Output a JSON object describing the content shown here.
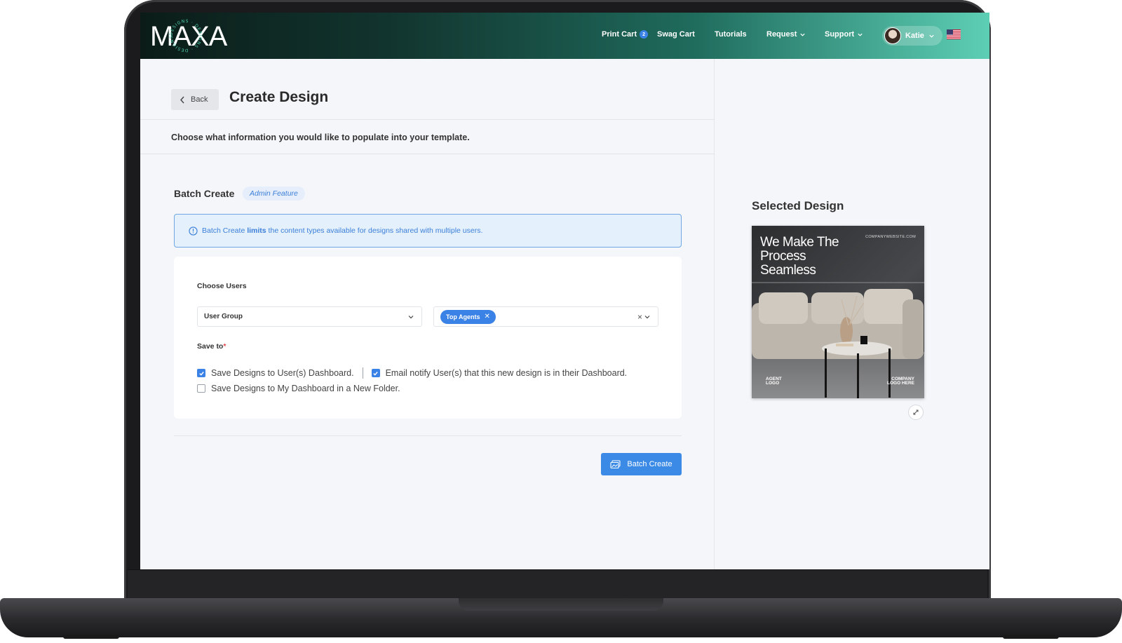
{
  "nav": {
    "logo_text": "MAXA",
    "logo_ring_text": "DESIGNS · DESIGNS · DESIGNS ·",
    "print_cart": "Print Cart",
    "print_cart_count": "2",
    "swag_cart": "Swag Cart",
    "tutorials": "Tutorials",
    "request": "Request",
    "support": "Support",
    "user_name": "Katie",
    "flag_icon": "us-flag-icon"
  },
  "header": {
    "back_label": "Back",
    "title": "Create Design",
    "subtitle": "Choose what information you would like to populate into your template."
  },
  "batch": {
    "title": "Batch Create",
    "badge": "Admin Feature",
    "info_prefix": "Batch Create ",
    "info_bold": "limits",
    "info_suffix": " the content types available for designs shared with multiple users.",
    "choose_users_label": "Choose Users",
    "user_select_value": "User Group",
    "group_chip": "Top Agents",
    "save_to_label": "Save to",
    "required_mark": "*",
    "options": [
      {
        "label": "Save Designs to User(s) Dashboard.",
        "checked": true
      },
      {
        "label": "Email notify User(s) that this new design is in their Dashboard.",
        "checked": true
      },
      {
        "label": "Save Designs to My Dashboard in a New Folder.",
        "checked": false
      }
    ],
    "submit_label": "Batch Create"
  },
  "selected_design": {
    "title": "Selected Design",
    "headline": "We Make The Process Seamless",
    "website": "COMPANYWEBSITE.COM",
    "agent_logo_line1": "AGENT",
    "agent_logo_line2": "LOGO",
    "company_logo_line1": "COMPANY",
    "company_logo_line2": "LOGO HERE"
  },
  "colors": {
    "accent": "#3b82e6",
    "nav_gradient_start": "#0b1c18",
    "nav_gradient_end": "#5dcfb4"
  }
}
